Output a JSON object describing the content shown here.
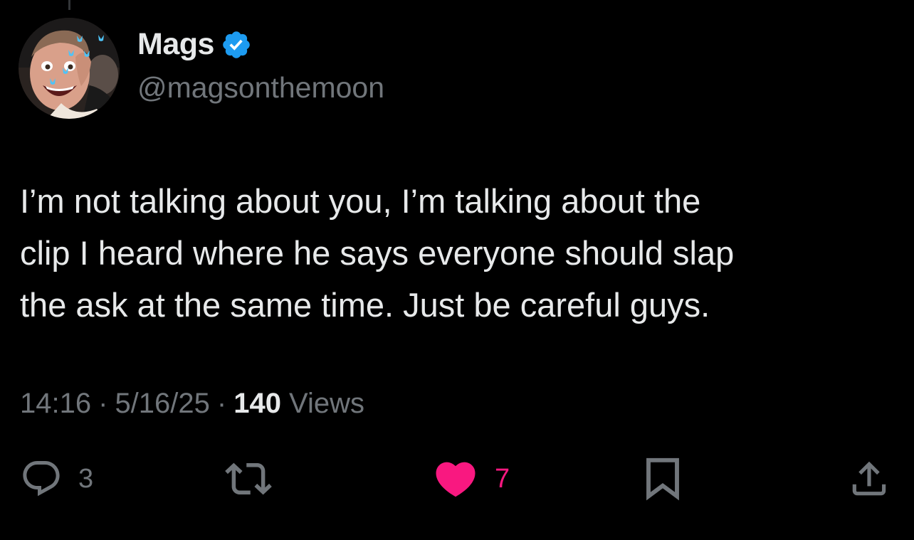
{
  "user": {
    "display_name": "Mags",
    "handle": "@magsonthemoon",
    "verified": true,
    "avatar": "avatar-photo"
  },
  "tweet": {
    "text": "I’m not talking about you, I’m talking about the\nclip I heard where he says everyone should slap\nthe ask at the same time. Just be careful guys."
  },
  "meta": {
    "time": "14:16",
    "separator": "·",
    "date": "5/16/25",
    "views_count": "140",
    "views_label": "Views"
  },
  "actions": {
    "reply": {
      "icon": "reply-icon",
      "count": "3"
    },
    "retweet": {
      "icon": "retweet-icon",
      "count": ""
    },
    "like": {
      "icon": "heart-icon",
      "count": "7",
      "liked": true
    },
    "bookmark": {
      "icon": "bookmark-icon"
    },
    "share": {
      "icon": "share-icon"
    }
  },
  "colors": {
    "background": "#000000",
    "text": "#e7e9ea",
    "secondary": "#71767b",
    "verified": "#1d9bf0",
    "like": "#f91880"
  }
}
